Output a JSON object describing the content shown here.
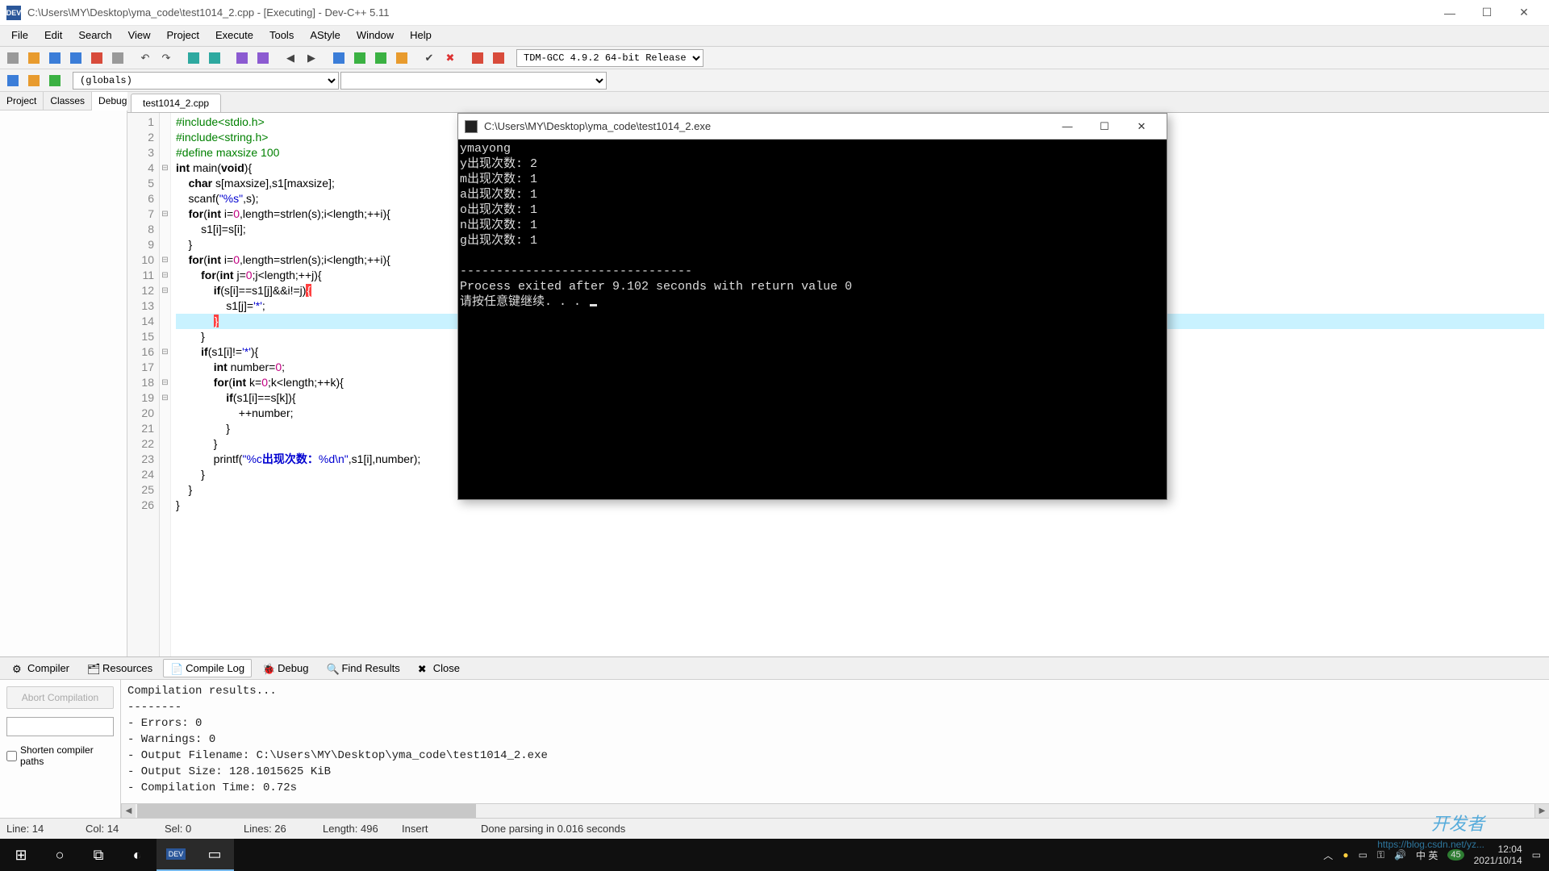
{
  "window": {
    "title": "C:\\Users\\MY\\Desktop\\yma_code\\test1014_2.cpp - [Executing] - Dev-C++ 5.11"
  },
  "menu": [
    "File",
    "Edit",
    "Search",
    "View",
    "Project",
    "Execute",
    "Tools",
    "AStyle",
    "Window",
    "Help"
  ],
  "compiler_selector": "TDM-GCC 4.9.2 64-bit Release",
  "globals_selector": "(globals)",
  "left_tabs": {
    "items": [
      "Project",
      "Classes",
      "Debug"
    ],
    "active": 2
  },
  "file_tab": "test1014_2.cpp",
  "code": {
    "lines": [
      {
        "n": 1,
        "fold": "",
        "html": "<span class='pp'>#include&lt;stdio.h&gt;</span>"
      },
      {
        "n": 2,
        "fold": "",
        "html": "<span class='pp'>#include&lt;string.h&gt;</span>"
      },
      {
        "n": 3,
        "fold": "",
        "html": "<span class='pp'>#define maxsize 100</span>"
      },
      {
        "n": 4,
        "fold": "⊟",
        "html": "<span class='kw'>int</span> main(<span class='kw'>void</span>){"
      },
      {
        "n": 5,
        "fold": "",
        "html": "    <span class='kw'>char</span> s[maxsize],s1[maxsize];"
      },
      {
        "n": 6,
        "fold": "",
        "html": "    scanf(<span class='str'>\"%s\"</span>,s);"
      },
      {
        "n": 7,
        "fold": "⊟",
        "html": "    <span class='kw'>for</span>(<span class='kw'>int</span> i=<span class='num'>0</span>,length=strlen(s);i&lt;length;++i){"
      },
      {
        "n": 8,
        "fold": "",
        "html": "        s1[i]=s[i];"
      },
      {
        "n": 9,
        "fold": "",
        "html": "    }"
      },
      {
        "n": 10,
        "fold": "⊟",
        "html": "    <span class='kw'>for</span>(<span class='kw'>int</span> i=<span class='num'>0</span>,length=strlen(s);i&lt;length;++i){"
      },
      {
        "n": 11,
        "fold": "⊟",
        "html": "        <span class='kw'>for</span>(<span class='kw'>int</span> j=<span class='num'>0</span>;j&lt;length;++j){"
      },
      {
        "n": 12,
        "fold": "⊟",
        "html": "            <span class='kw'>if</span>(s[i]==s1[j]&amp;&amp;i!=j)<span class='brace-match'>{</span>"
      },
      {
        "n": 13,
        "fold": "",
        "html": "                s1[j]=<span class='str'>'*'</span>;"
      },
      {
        "n": 14,
        "fold": "",
        "hl": true,
        "html": "            <span class='brace-match2'>}</span>"
      },
      {
        "n": 15,
        "fold": "",
        "html": "        }"
      },
      {
        "n": 16,
        "fold": "⊟",
        "html": "        <span class='kw'>if</span>(s1[i]!=<span class='str'>'*'</span>){"
      },
      {
        "n": 17,
        "fold": "",
        "html": "            <span class='kw'>int</span> number=<span class='num'>0</span>;"
      },
      {
        "n": 18,
        "fold": "⊟",
        "html": "            <span class='kw'>for</span>(<span class='kw'>int</span> k=<span class='num'>0</span>;k&lt;length;++k){"
      },
      {
        "n": 19,
        "fold": "⊟",
        "html": "                <span class='kw'>if</span>(s1[i]==s[k]){"
      },
      {
        "n": 20,
        "fold": "",
        "html": "                    ++number;"
      },
      {
        "n": 21,
        "fold": "",
        "html": "                }"
      },
      {
        "n": 22,
        "fold": "",
        "html": "            }"
      },
      {
        "n": 23,
        "fold": "",
        "html": "            printf(<span class='str'>\"%c</span><span class='chinese'>出现次数：</span><span class='str'>%d\\n\"</span>,s1[i],number);"
      },
      {
        "n": 24,
        "fold": "",
        "html": "        }"
      },
      {
        "n": 25,
        "fold": "",
        "html": "    }"
      },
      {
        "n": 26,
        "fold": "",
        "html": "}"
      }
    ]
  },
  "console": {
    "title": "C:\\Users\\MY\\Desktop\\yma_code\\test1014_2.exe",
    "lines": [
      "ymayong",
      "y出现次数: 2",
      "m出现次数: 1",
      "a出现次数: 1",
      "o出现次数: 1",
      "n出现次数: 1",
      "g出现次数: 1",
      "",
      "--------------------------------",
      "Process exited after 9.102 seconds with return value 0",
      "请按任意键继续. . . "
    ]
  },
  "bottom_tabs": {
    "items": [
      "Compiler",
      "Resources",
      "Compile Log",
      "Debug",
      "Find Results",
      "Close"
    ],
    "active": 2
  },
  "abort_label": "Abort Compilation",
  "shorten_label": "Shorten compiler paths",
  "compile_log": [
    "Compilation results...",
    "--------",
    "- Errors: 0",
    "- Warnings: 0",
    "- Output Filename: C:\\Users\\MY\\Desktop\\yma_code\\test1014_2.exe",
    "- Output Size: 128.1015625 KiB",
    "- Compilation Time: 0.72s"
  ],
  "status": {
    "line": "Line:   14",
    "col": "Col:   14",
    "sel": "Sel:   0",
    "lines": "Lines:   26",
    "length": "Length:   496",
    "mode": "Insert",
    "msg": "Done parsing in 0.016 seconds"
  },
  "taskbar": {
    "tray_text": "中 英",
    "tray_badge": "45",
    "time": "12:04",
    "date": "2021/10/14"
  },
  "watermark": {
    "big": "开发者",
    "small": "https://blog.csdn.net/yz..."
  }
}
